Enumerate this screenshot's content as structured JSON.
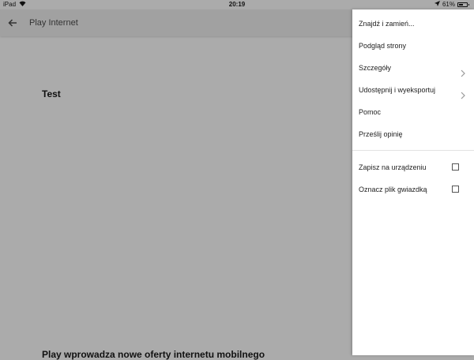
{
  "status_bar": {
    "device": "iPad",
    "time": "20:19",
    "battery": "61%",
    "battery_level": 0.61,
    "icons": [
      "wifi-icon",
      "location-arrow-icon",
      "battery-icon"
    ]
  },
  "app_bar": {
    "title": "Play Internet",
    "back_icon": "arrow-left-icon"
  },
  "document": {
    "heading1": "Test",
    "heading2": "Play wprowadza nowe oferty internetu mobilnego"
  },
  "menu": {
    "items": [
      {
        "label": "Znajdź i zamień..."
      },
      {
        "label": "Podgląd strony"
      },
      {
        "label": "Szczegóły",
        "icon": "chevron-right-icon"
      },
      {
        "label": "Udostępnij i wyeksportuj",
        "icon": "chevron-right-icon"
      },
      {
        "label": "Pomoc"
      },
      {
        "label": "Prześlij opinię"
      }
    ],
    "toggles": [
      {
        "label": "Zapisz na urządzeniu",
        "checked": false
      },
      {
        "label": "Oznacz plik gwiazdką",
        "checked": false
      }
    ]
  }
}
